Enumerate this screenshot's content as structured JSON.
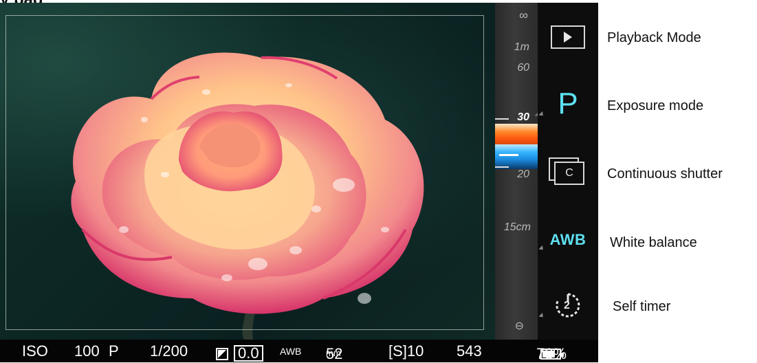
{
  "caption": {
    "fragment": "y pag"
  },
  "dial": {
    "infinity": "∞",
    "near_1m": "1m",
    "tick_60": "60",
    "tick_30": "30",
    "tick_20": "20",
    "near_15cm": "15cm",
    "focus_symbol": "⊖"
  },
  "icons": {
    "playback": "playback-icon",
    "exposure_mode": "P",
    "continuous": "C",
    "awb": "AWB",
    "timer_number": "2"
  },
  "labels": {
    "playback": "Playback Mode",
    "exposure": "Exposure mode",
    "continuous": "Continuous shutter",
    "white_balance": "White balance",
    "self_timer": "Self timer"
  },
  "status": {
    "iso_label": "ISO",
    "iso_value": "100",
    "mode": "P",
    "shutter": "1/200",
    "ev": "0.0",
    "awb": "AWB",
    "focal_num": "52",
    "focal_unit": "mm",
    "shots": "[S]10",
    "remaining": "543",
    "battery": "73%",
    "battery_level": 0.73
  },
  "colors": {
    "accent": "#5de0f0",
    "background": "#0b0b0b"
  }
}
